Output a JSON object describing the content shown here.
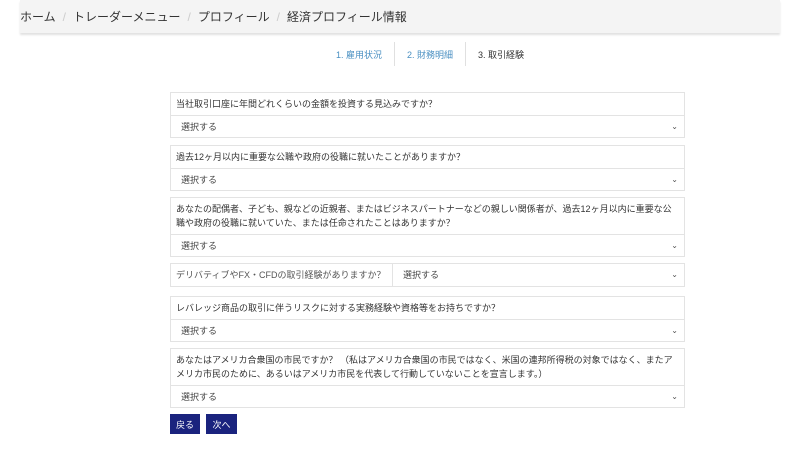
{
  "breadcrumb": [
    "ホーム",
    "トレーダーメニュー",
    "プロフィール",
    "経済プロフィール情報"
  ],
  "steps": [
    "1. 雇用状況",
    "2. 財務明細",
    "3. 取引経験"
  ],
  "questions": [
    {
      "label": "当社取引口座に年間どれくらいの金額を投資する見込みですか？",
      "value": "選択する"
    },
    {
      "label": "過去12ヶ月以内に重要な公職や政府の役職に就いたことがありますか？",
      "value": "選択する"
    },
    {
      "label": "あなたの配偶者、子ども、親などの近親者、またはビジネスパートナーなどの親しい関係者が、過去12ヶ月以内に重要な公職や政府の役職に就いていた、または任命されたことはありますか？",
      "value": "選択する"
    },
    {
      "label": "デリバティブやFX・CFDの取引経験がありますか？",
      "value": "選択する"
    },
    {
      "label": "レバレッジ商品の取引に伴うリスクに対する実務経験や資格等をお持ちですか？",
      "value": "選択する"
    },
    {
      "label": "あなたはアメリカ合衆国の市民ですか？ （私はアメリカ合衆国の市民ではなく、米国の連邦所得税の対象ではなく、またアメリカ市民のために、あるいはアメリカ市民を代表して行動していないことを宣言します。）",
      "value": "選択する"
    }
  ],
  "buttons": {
    "back": "戻る",
    "next": "次へ"
  },
  "colors": {
    "button": "#1a237e",
    "step_done": "#4a90c2"
  }
}
